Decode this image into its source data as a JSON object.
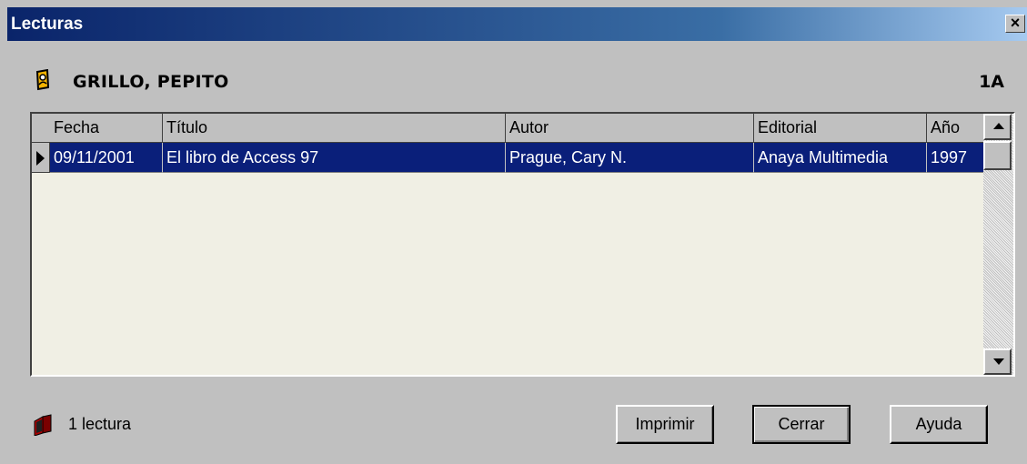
{
  "window": {
    "title": "Lecturas",
    "close_glyph": "×"
  },
  "student": {
    "name": "GRILLO, PEPITO",
    "group": "1A",
    "icon": "student-card-icon"
  },
  "table": {
    "columns": [
      "Fecha",
      "Título",
      "Autor",
      "Editorial",
      "Año"
    ],
    "rows": [
      {
        "fecha": "09/11/2001",
        "titulo": "El libro de Access 97",
        "autor": "Prague, Cary N.",
        "editorial": "Anaya Multimedia",
        "anio": "1997"
      }
    ],
    "selected_row_color": "#0a1f7a",
    "empty_color": "#f0efe4"
  },
  "footer": {
    "count_label": "1 lectura",
    "count_icon": "books-icon",
    "buttons": {
      "print": "Imprimir",
      "close": "Cerrar",
      "help": "Ayuda"
    }
  }
}
